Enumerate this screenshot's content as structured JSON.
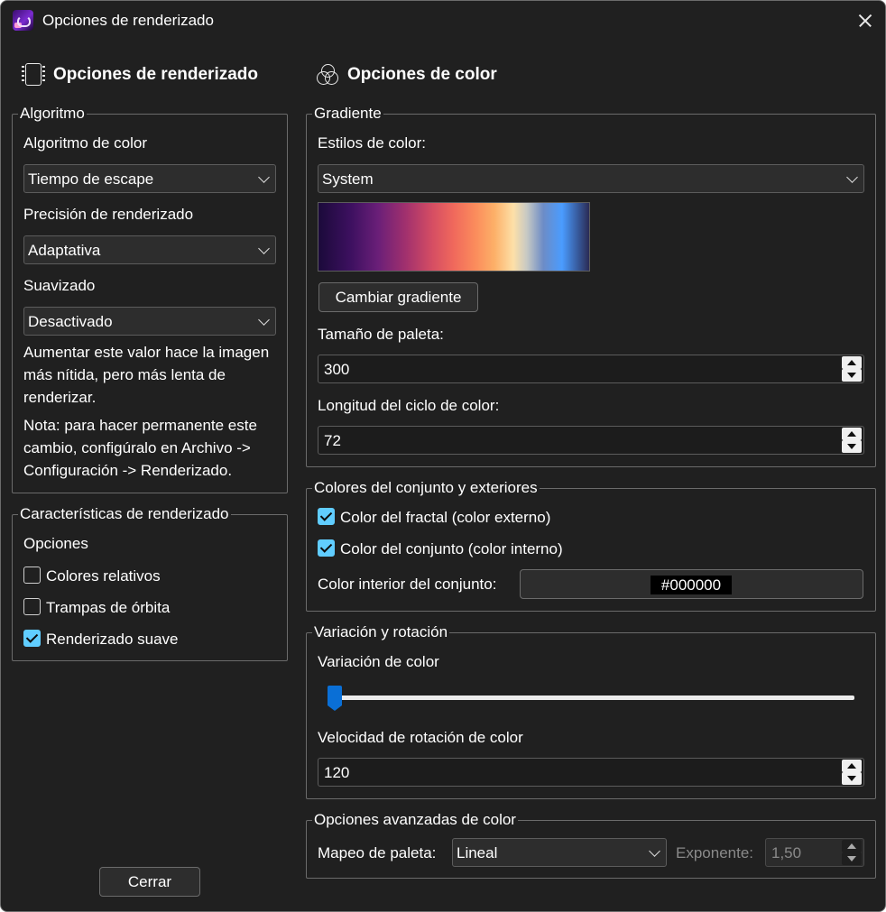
{
  "window": {
    "title": "Opciones de renderizado"
  },
  "render_options": {
    "heading": "Opciones de renderizado",
    "algorithm_group": {
      "legend": "Algoritmo",
      "color_algorithm_label": "Algoritmo de color",
      "color_algorithm_value": "Tiempo de escape",
      "precision_label": "Precisión de renderizado",
      "precision_value": "Adaptativa",
      "smoothing_label": "Suavizado",
      "smoothing_value": "Desactivado",
      "hint": "Aumentar este valor hace la imagen más nítida, pero más lenta de renderizar.",
      "note": "Nota: para hacer permanente este cambio, configúralo en Archivo -> Configuración -> Renderizado."
    },
    "features_group": {
      "legend": "Características de renderizado",
      "options_label": "Opciones",
      "relative_colors": {
        "label": "Colores relativos",
        "checked": false
      },
      "orbit_traps": {
        "label": "Trampas de órbita",
        "checked": false
      },
      "smooth_render": {
        "label": "Renderizado suave",
        "checked": true
      }
    },
    "close_label": "Cerrar"
  },
  "color_options": {
    "heading": "Opciones de color",
    "gradient_group": {
      "legend": "Gradiente",
      "styles_label": "Estilos de color:",
      "styles_value": "System",
      "change_gradient_label": "Cambiar gradiente",
      "palette_size_label": "Tamaño de paleta:",
      "palette_size_value": "300",
      "cycle_length_label": "Longitud del ciclo de color:",
      "cycle_length_value": "72"
    },
    "set_colors_group": {
      "legend": "Colores del conjunto y exteriores",
      "fractal_color": {
        "label": "Color del fractal (color externo)",
        "checked": true
      },
      "set_color": {
        "label": "Color del conjunto (color interno)",
        "checked": true
      },
      "interior_label": "Color interior del conjunto:",
      "interior_value": "#000000"
    },
    "variation_group": {
      "legend": "Variación y rotación",
      "variation_label": "Variación de color",
      "variation_value": 0,
      "rotation_speed_label": "Velocidad de rotación de color",
      "rotation_speed_value": "120"
    },
    "advanced_group": {
      "legend": "Opciones avanzadas de color",
      "mapping_label": "Mapeo de paleta:",
      "mapping_value": "Lineal",
      "exponent_label": "Exponente:",
      "exponent_value": "1,50"
    }
  },
  "colors": {
    "accent": "#60cdff",
    "slider": "#0a6fd6",
    "background": "#202020"
  },
  "icons": {
    "app": "app-logo-icon",
    "close": "close-icon",
    "chip": "chip-icon",
    "colors": "color-circles-icon"
  }
}
